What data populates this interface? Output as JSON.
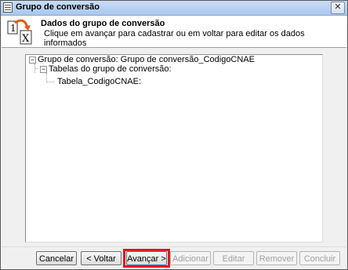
{
  "window": {
    "title": "Grupo de conversão",
    "close_symbol": "✕"
  },
  "header": {
    "title": "Dados do grupo de conversão",
    "subtitle": "Clique em avançar para cadastrar ou em voltar para editar os dados informados"
  },
  "tree": {
    "root": {
      "label": "Grupo de conversão: Grupo de conversão_CodigoCNAE",
      "expander": "−"
    },
    "child": {
      "label": "Tabelas do grupo de conversão:",
      "expander": "−"
    },
    "leaf": {
      "label": "Tabela_CodigoCNAE:"
    }
  },
  "buttons": {
    "cancel": "Cancelar",
    "back": "< Voltar",
    "next": "Avançar >",
    "add": "Adicionar",
    "edit": "Editar",
    "remove": "Remover",
    "finish": "Concluir"
  },
  "colors": {
    "highlight": "#e0191b",
    "titlebar": "#b9d1f0"
  }
}
